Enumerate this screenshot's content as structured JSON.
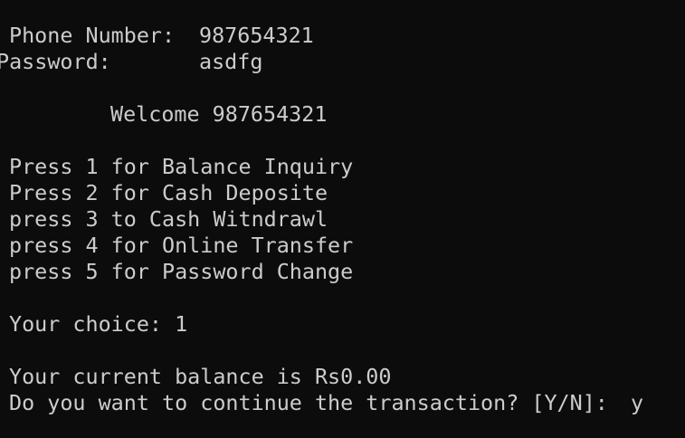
{
  "login": {
    "phone_label": "Phone Number:",
    "phone_value": "987654321",
    "password_label": "Password:",
    "password_value": "asdfg"
  },
  "welcome": "Welcome 987654321",
  "menu": [
    "Press 1 for Balance Inquiry",
    "Press 2 for Cash Deposite",
    "press 3 to Cash Witndrawl",
    "press 4 for Online Transfer",
    "press 5 for Password Change"
  ],
  "choice": {
    "label": "Your choice: 1"
  },
  "result": {
    "balance_text": "Your current balance is Rs0.00",
    "continue_prompt": "Do you want to continue the transaction? [Y/N]:",
    "continue_answer": "y"
  },
  "colors": {
    "background": "#0c0c0c",
    "text": "#cccccc"
  }
}
